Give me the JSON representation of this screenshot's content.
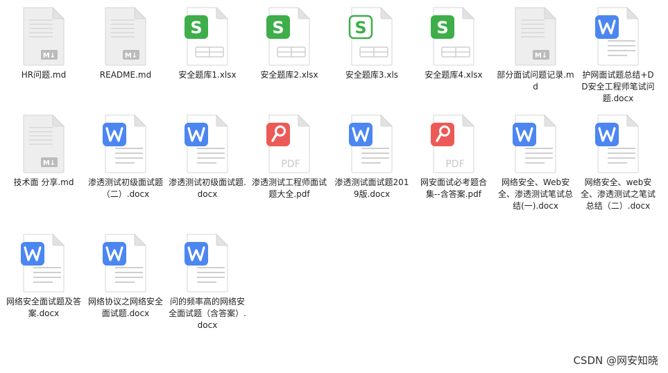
{
  "files": [
    {
      "name": "HR问题.md",
      "type": "md"
    },
    {
      "name": "README.md",
      "type": "md"
    },
    {
      "name": "安全题库1.xlsx",
      "type": "xlsx"
    },
    {
      "name": "安全题库2.xlsx",
      "type": "xlsx"
    },
    {
      "name": "安全题库3.xls",
      "type": "xls"
    },
    {
      "name": "安全题库4.xlsx",
      "type": "xlsx"
    },
    {
      "name": "部分面试问题记录.md",
      "type": "md"
    },
    {
      "name": "护网面试题总结+DD安全工程师笔试问题.docx",
      "type": "docx"
    },
    {
      "name": "技术面 分享.md",
      "type": "md"
    },
    {
      "name": "渗透测试初级面试题（二）.docx",
      "type": "docx"
    },
    {
      "name": "渗透测试初级面试题.docx",
      "type": "docx"
    },
    {
      "name": "渗透测试工程师面试题大全.pdf",
      "type": "pdf"
    },
    {
      "name": "渗透测试面试题2019版.docx",
      "type": "docx"
    },
    {
      "name": "网安面试必考题合集--含答案.pdf",
      "type": "pdf"
    },
    {
      "name": "网络安全、Web安全、渗透测试笔试总结(一).docx",
      "type": "docx"
    },
    {
      "name": "网络安全、web安全、渗透测试之笔试总结（二）.docx",
      "type": "docx"
    },
    {
      "name": "网络安全面试题及答案.docx",
      "type": "docx"
    },
    {
      "name": "网络协议之网络安全面试题.docx",
      "type": "docx"
    },
    {
      "name": "问的频率高的网络安全面试题（含答案）.docx",
      "type": "docx"
    }
  ],
  "icon_labels": {
    "md": "M↓",
    "pdf": "PDF",
    "word": "W",
    "sheet": "S"
  },
  "colors": {
    "word": "#4c86f0",
    "sheet": "#3dae49",
    "pdf": "#ec5a58",
    "md_page": "#eeeeee",
    "md_badge": "#bbbbbb"
  },
  "watermark": "CSDN @网安知晓"
}
